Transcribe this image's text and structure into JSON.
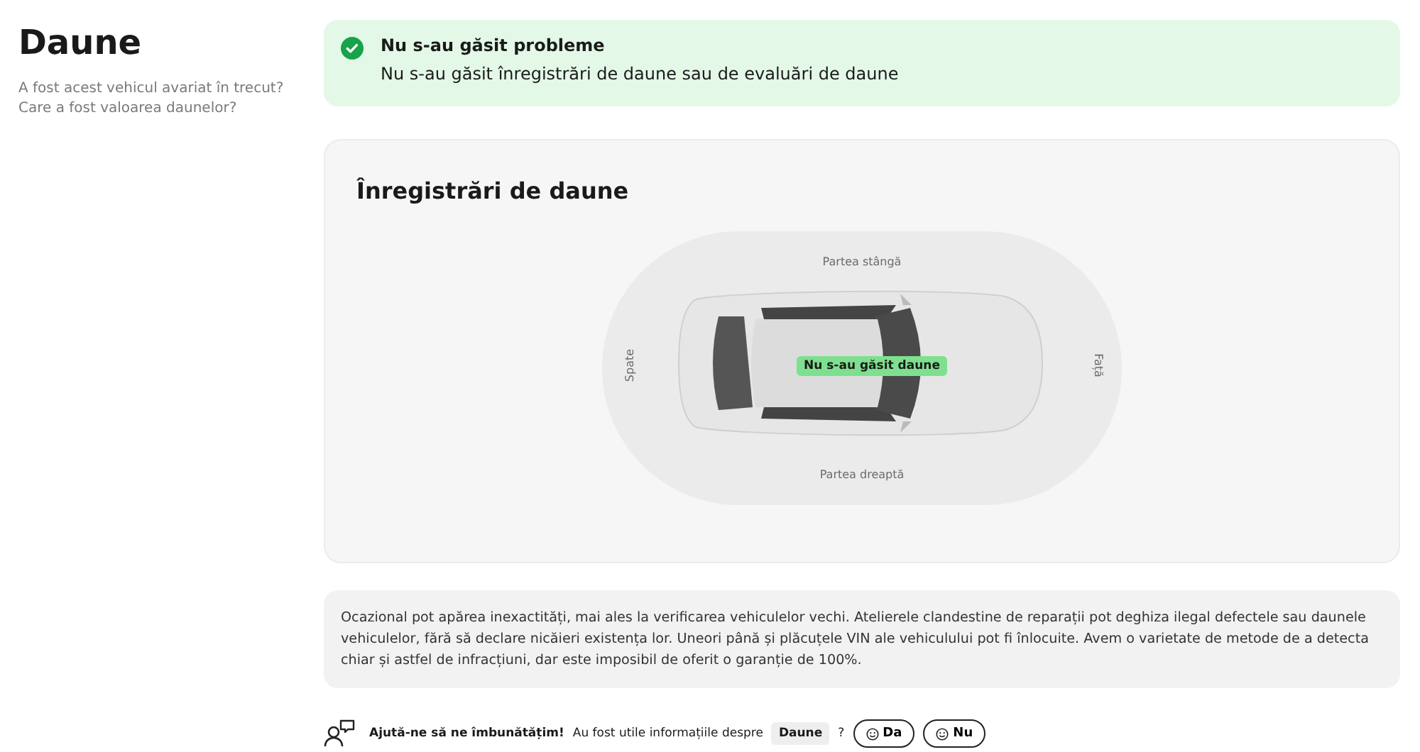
{
  "header": {
    "title": "Daune",
    "description_lines": [
      "A fost acest vehicul avariat în trecut?",
      "Care a fost valoarea daunelor?"
    ]
  },
  "status": {
    "kind": "success",
    "title": "Nu s-au găsit probleme",
    "message": "Nu s-au găsit înregistrări de daune sau de evaluări de daune"
  },
  "records": {
    "title": "Înregistrări de daune",
    "labels": {
      "top": "Partea stângă",
      "bottom": "Partea dreaptă",
      "left": "Spate",
      "right": "Față"
    },
    "badge": "Nu s-au găsit daune"
  },
  "disclaimer": "Ocazional pot apărea inexactități, mai ales la verificarea vehiculelor vechi. Atelierele clandestine de reparații pot deghiza ilegal defectele sau daunele vehiculelor, fără să declare nicăieri existența lor. Uneori până și plăcuțele VIN ale vehiculului pot fi înlocuite. Avem o varietate de metode de a detecta chiar și astfel de infracțiuni, dar este imposibil de oferit o garanție de 100%.",
  "feedback": {
    "prompt": "Ajută-ne să ne îmbunătățim!",
    "question": "Au fost utile informațiile despre",
    "topic": "Daune",
    "question_mark": "?",
    "buttons": [
      {
        "label": "Da"
      },
      {
        "label": "Nu"
      }
    ]
  }
}
